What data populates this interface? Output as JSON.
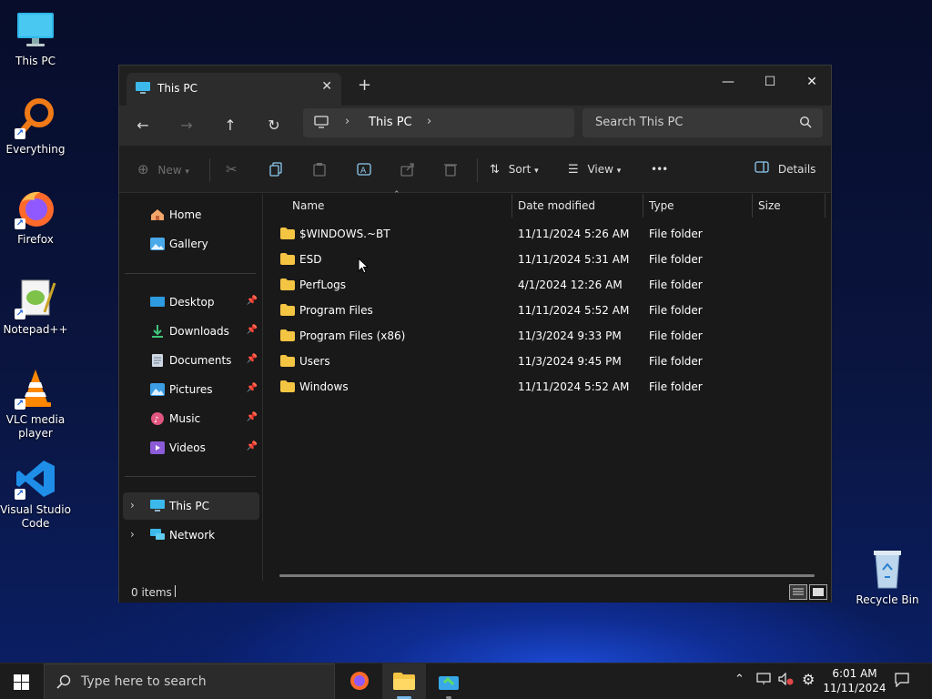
{
  "desktop": {
    "icons": [
      {
        "label": "This PC"
      },
      {
        "label": "Everything"
      },
      {
        "label": "Firefox"
      },
      {
        "label": "Notepad++"
      },
      {
        "label": "VLC media player"
      },
      {
        "label": "Visual Studio Code"
      },
      {
        "label": "Recycle Bin"
      }
    ]
  },
  "window": {
    "tab_title": "This PC",
    "controls": {
      "minimize": "—",
      "maximize": "☐",
      "close": "✕"
    },
    "nav": {
      "back": "←",
      "forward": "→",
      "up": "↑",
      "refresh": "↻"
    },
    "address": {
      "crumb": "This PC"
    },
    "search": {
      "placeholder": "Search This PC"
    },
    "toolbar": {
      "new_label": "New",
      "sort_label": "Sort",
      "view_label": "View",
      "more_label": "•••",
      "details_label": "Details"
    },
    "sidebar": {
      "items": [
        {
          "label": "Home"
        },
        {
          "label": "Gallery"
        },
        {
          "label": "Desktop"
        },
        {
          "label": "Downloads"
        },
        {
          "label": "Documents"
        },
        {
          "label": "Pictures"
        },
        {
          "label": "Music"
        },
        {
          "label": "Videos"
        },
        {
          "label": "This PC"
        },
        {
          "label": "Network"
        }
      ]
    },
    "columns": {
      "name": "Name",
      "date": "Date modified",
      "type": "Type",
      "size": "Size"
    },
    "rows": [
      {
        "name": "$WINDOWS.~BT",
        "date": "11/11/2024 5:26 AM",
        "type": "File folder"
      },
      {
        "name": "ESD",
        "date": "11/11/2024 5:31 AM",
        "type": "File folder"
      },
      {
        "name": "PerfLogs",
        "date": "4/1/2024 12:26 AM",
        "type": "File folder"
      },
      {
        "name": "Program Files",
        "date": "11/11/2024 5:52 AM",
        "type": "File folder"
      },
      {
        "name": "Program Files (x86)",
        "date": "11/3/2024 9:33 PM",
        "type": "File folder"
      },
      {
        "name": "Users",
        "date": "11/3/2024 9:45 PM",
        "type": "File folder"
      },
      {
        "name": "Windows",
        "date": "11/11/2024 5:52 AM",
        "type": "File folder"
      }
    ],
    "status": {
      "items": "0 items"
    }
  },
  "taskbar": {
    "search_placeholder": "Type here to search",
    "clock": {
      "time": "6:01 AM",
      "date": "11/11/2024"
    }
  },
  "colors": {
    "accent": "#76b9ed",
    "folder": "#f4c443",
    "window_bg": "#191919"
  }
}
